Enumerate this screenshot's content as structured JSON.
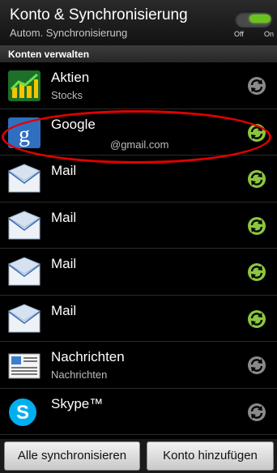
{
  "header": {
    "title": "Konto & Synchronisierung",
    "subtitle": "Autom. Synchronisierung",
    "toggle": {
      "off_label": "Off",
      "on_label": "On",
      "state": "on"
    }
  },
  "section_title": "Konten verwalten",
  "accounts": [
    {
      "name": "Aktien",
      "sub": "Stocks",
      "icon": "stocks-icon",
      "sync": "inactive"
    },
    {
      "name": "Google",
      "sub": "@gmail.com",
      "icon": "google-icon",
      "sync": "active"
    },
    {
      "name": "Mail",
      "sub": "",
      "icon": "mail-icon",
      "sync": "active"
    },
    {
      "name": "Mail",
      "sub": "",
      "icon": "mail-icon",
      "sync": "active"
    },
    {
      "name": "Mail",
      "sub": "",
      "icon": "mail-icon",
      "sync": "active"
    },
    {
      "name": "Mail",
      "sub": "",
      "icon": "mail-icon",
      "sync": "active"
    },
    {
      "name": "Nachrichten",
      "sub": "Nachrichten",
      "icon": "news-icon",
      "sync": "inactive"
    },
    {
      "name": "Skype™",
      "sub": "",
      "icon": "skype-icon",
      "sync": "inactive"
    }
  ],
  "footer": {
    "sync_all_label": "Alle synchronisieren",
    "add_account_label": "Konto hinzufügen"
  },
  "colors": {
    "sync_active": "#8cc63f",
    "sync_inactive": "#8a8a8a",
    "highlight": "#e00000"
  }
}
